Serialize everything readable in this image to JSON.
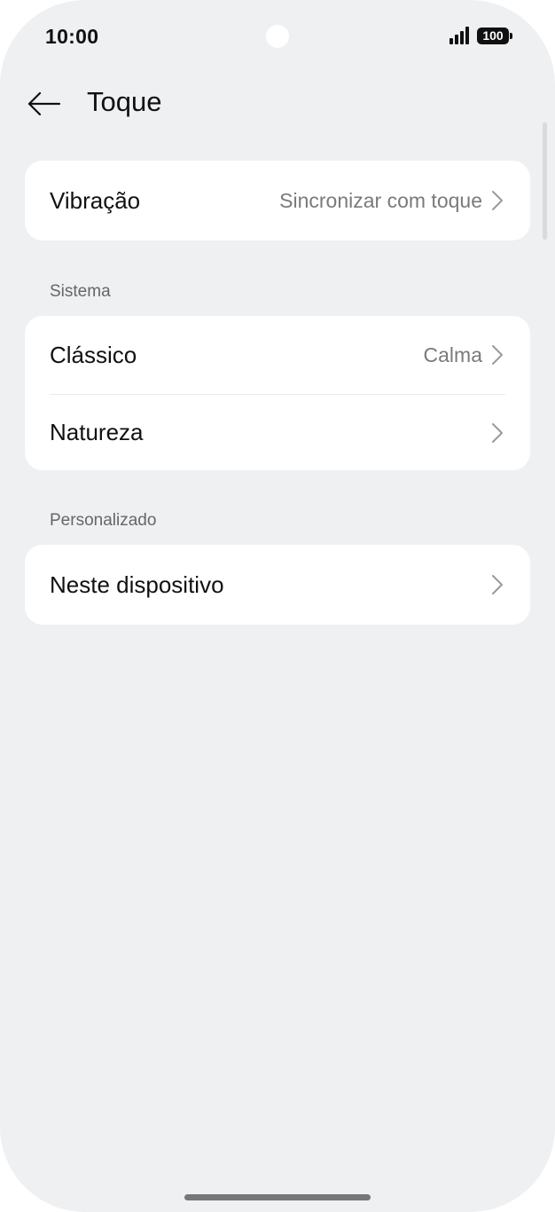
{
  "status_bar": {
    "time": "10:00",
    "battery": "100",
    "icons": [
      "signal-icon",
      "battery-icon"
    ]
  },
  "header": {
    "title": "Toque",
    "back_icon": "arrow-left-icon"
  },
  "vibration": {
    "label": "Vibração",
    "value": "Sincronizar com toque"
  },
  "system": {
    "section_label": "Sistema",
    "items": [
      {
        "label": "Clássico",
        "value": "Calma"
      },
      {
        "label": "Natureza",
        "value": ""
      }
    ]
  },
  "custom": {
    "section_label": "Personalizado",
    "items": [
      {
        "label": "Neste dispositivo",
        "value": ""
      }
    ]
  },
  "colors": {
    "background": "#eff0f2",
    "card": "#ffffff",
    "text_primary": "#111111",
    "text_secondary": "#7a7a7a",
    "chevron": "#9a9a9a"
  }
}
